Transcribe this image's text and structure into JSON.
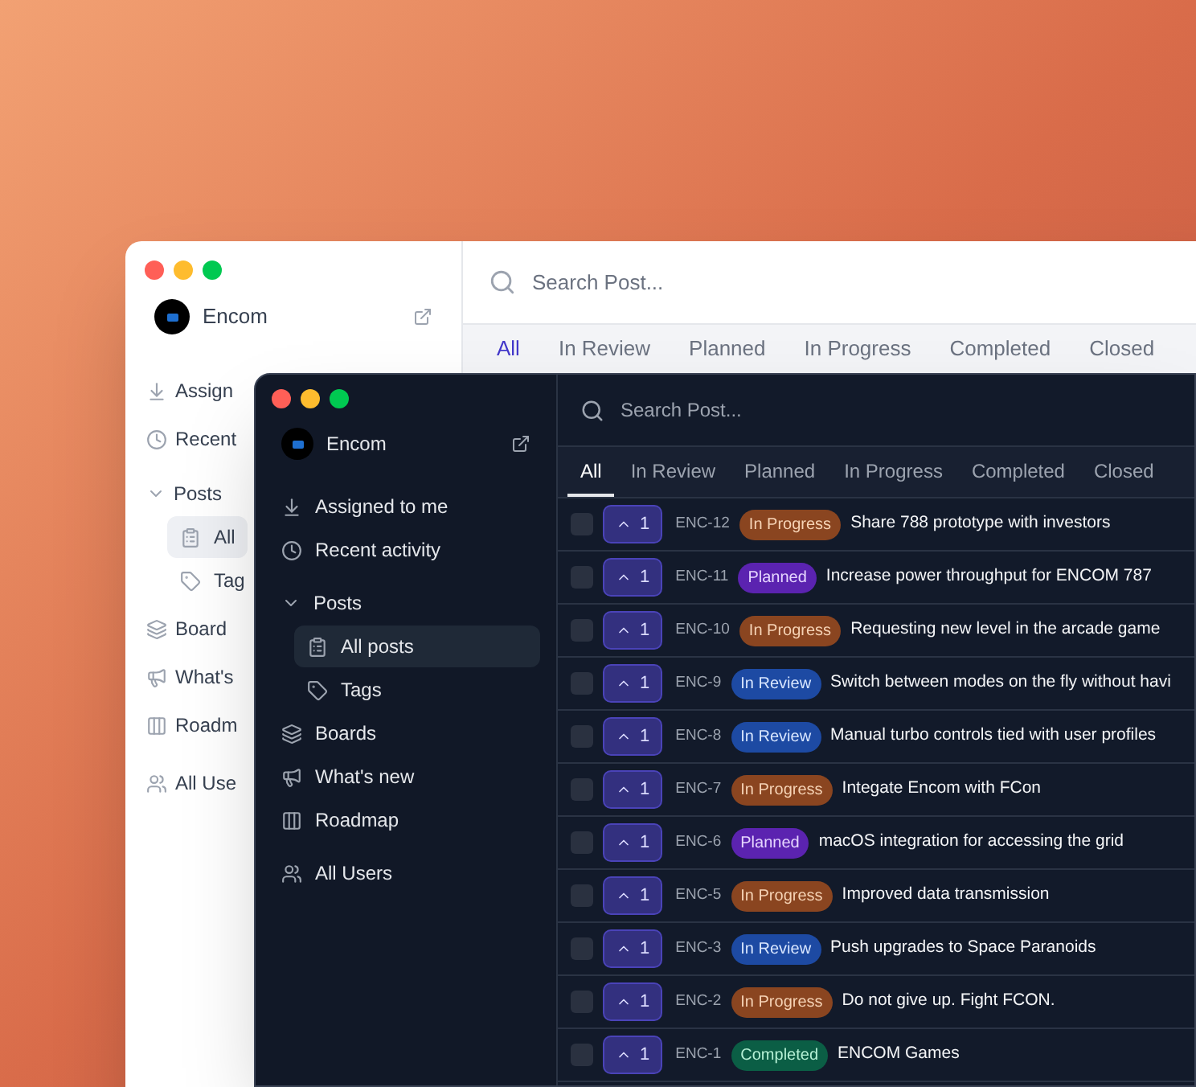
{
  "back_window": {
    "brand": "Encom",
    "search": {
      "placeholder": "Search Post..."
    },
    "tabs": [
      {
        "label": "All",
        "selected": true
      },
      {
        "label": "In Review",
        "selected": false
      },
      {
        "label": "Planned",
        "selected": false
      },
      {
        "label": "In Progress",
        "selected": false
      },
      {
        "label": "Completed",
        "selected": false
      },
      {
        "label": "Closed",
        "selected": false
      }
    ],
    "sidebar": {
      "items": [
        {
          "label": "Assign",
          "selected": false
        },
        {
          "label": "Recent",
          "selected": false
        },
        {
          "label": "Posts",
          "expanded": true,
          "children": [
            {
              "label": "All",
              "selected": true
            },
            {
              "label": "Tag",
              "selected": false
            }
          ]
        },
        {
          "label": "Board",
          "selected": false
        },
        {
          "label": "What's",
          "selected": false
        },
        {
          "label": "Roadm",
          "selected": false
        },
        {
          "label": "All Use",
          "selected": false
        }
      ]
    }
  },
  "front_window": {
    "brand": "Encom",
    "search": {
      "placeholder": "Search Post..."
    },
    "tabs": [
      {
        "label": "All",
        "selected": true
      },
      {
        "label": "In Review",
        "selected": false
      },
      {
        "label": "Planned",
        "selected": false
      },
      {
        "label": "In Progress",
        "selected": false
      },
      {
        "label": "Completed",
        "selected": false
      },
      {
        "label": "Closed",
        "selected": false
      }
    ],
    "sidebar": {
      "items": [
        {
          "label": "Assigned to me",
          "selected": false
        },
        {
          "label": "Recent activity",
          "selected": false
        },
        {
          "label": "Posts",
          "expanded": true,
          "children": [
            {
              "label": "All posts",
              "selected": true
            },
            {
              "label": "Tags",
              "selected": false
            }
          ]
        },
        {
          "label": "Boards",
          "selected": false
        },
        {
          "label": "What's new",
          "selected": false
        },
        {
          "label": "Roadmap",
          "selected": false
        },
        {
          "label": "All Users",
          "selected": false
        }
      ]
    },
    "posts": [
      {
        "checked": false,
        "votes": "1",
        "id": "ENC-12",
        "status": {
          "kind": "in_progress",
          "label": "In Progress"
        },
        "title": "Share 788 prototype with investors"
      },
      {
        "checked": false,
        "votes": "1",
        "id": "ENC-11",
        "status": {
          "kind": "planned",
          "label": "Planned"
        },
        "title": "Increase power throughput for ENCOM 787"
      },
      {
        "checked": false,
        "votes": "1",
        "id": "ENC-10",
        "status": {
          "kind": "in_progress",
          "label": "In Progress"
        },
        "title": "Requesting new level in the arcade game"
      },
      {
        "checked": false,
        "votes": "1",
        "id": "ENC-9",
        "status": {
          "kind": "in_review",
          "label": "In Review"
        },
        "title": "Switch between modes on the fly without havi"
      },
      {
        "checked": false,
        "votes": "1",
        "id": "ENC-8",
        "status": {
          "kind": "in_review",
          "label": "In Review"
        },
        "title": "Manual turbo controls tied with user profiles"
      },
      {
        "checked": false,
        "votes": "1",
        "id": "ENC-7",
        "status": {
          "kind": "in_progress",
          "label": "In Progress"
        },
        "title": "Integate Encom with FCon"
      },
      {
        "checked": false,
        "votes": "1",
        "id": "ENC-6",
        "status": {
          "kind": "planned",
          "label": "Planned"
        },
        "title": "macOS integration for accessing the grid"
      },
      {
        "checked": false,
        "votes": "1",
        "id": "ENC-5",
        "status": {
          "kind": "in_progress",
          "label": "In Progress"
        },
        "title": "Improved data transmission"
      },
      {
        "checked": false,
        "votes": "1",
        "id": "ENC-3",
        "status": {
          "kind": "in_review",
          "label": "In Review"
        },
        "title": "Push upgrades to Space Paranoids"
      },
      {
        "checked": false,
        "votes": "1",
        "id": "ENC-2",
        "status": {
          "kind": "in_progress",
          "label": "In Progress"
        },
        "title": "Do not give up. Fight FCON."
      },
      {
        "checked": false,
        "votes": "1",
        "id": "ENC-1",
        "status": {
          "kind": "completed",
          "label": "Completed"
        },
        "title": "ENCOM Games"
      }
    ]
  }
}
